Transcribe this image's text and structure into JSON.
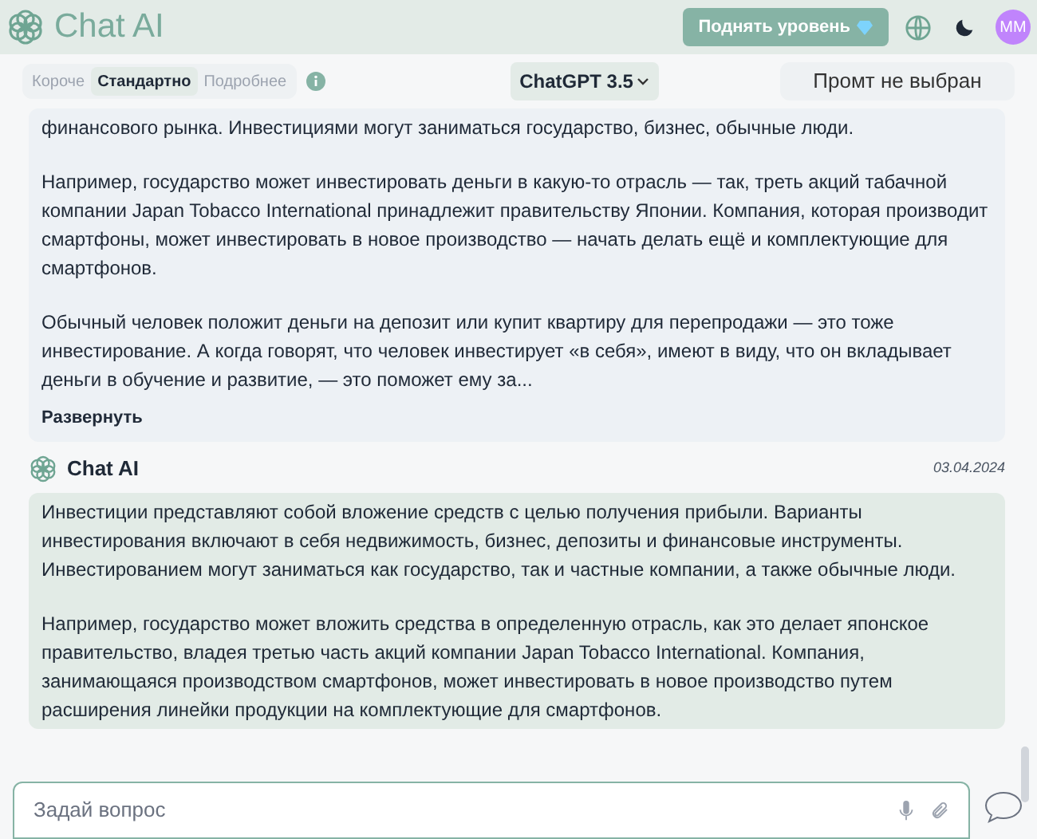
{
  "header": {
    "logo": "Chat AI",
    "upgrade_button": "Поднять уровень",
    "avatar": "MM"
  },
  "toolbar": {
    "lengths": [
      {
        "label": "Короче",
        "selected": false
      },
      {
        "label": "Стандартно",
        "selected": true
      },
      {
        "label": "Подробнее",
        "selected": false
      }
    ],
    "model": "ChatGPT 3.5",
    "prompt": "Промт не выбран"
  },
  "messages": [
    {
      "kind": "user",
      "paragraphs": [
        "финансового рынка. Инвестициями могут заниматься государство, бизнес, обычные люди.",
        "Например, государство может инвестировать деньги в какую-то отрасль — так, треть акций табачной компании Japan Tobacco International принадлежит правительству Японии. Компания, которая производит смартфоны, может инвестировать в новое производство — начать делать ещё и комплектующие для смартфонов.",
        "Обычный человек положит деньги на депозит или купит квартиру для перепродажи — это тоже инвестирование. А когда говорят, что человек инвестирует «в себя», имеют в виду, что он вкладывает деньги в обучение и развитие, — это поможет ему за..."
      ],
      "expand": "Развернуть"
    },
    {
      "kind": "ai",
      "author": "Chat AI",
      "date": "03.04.2024",
      "paragraphs": [
        "Инвестиции представляют собой вложение средств с целью получения прибыли. Варианты инвестирования включают в себя недвижимость, бизнес, депозиты и финансовые инструменты. Инвестированием могут заниматься как государство, так и частные компании, а также обычные люди.",
        "Например, государство может вложить средства в определенную отрасль, как это делает японское правительство, владея третью часть акций компании Japan Tobacco International. Компания, занимающаяся производством смартфонов, может инвестировать в новое производство путем расширения линейки продукции на комплектующие для смартфонов."
      ]
    }
  ],
  "input": {
    "placeholder": "Задай вопрос"
  }
}
